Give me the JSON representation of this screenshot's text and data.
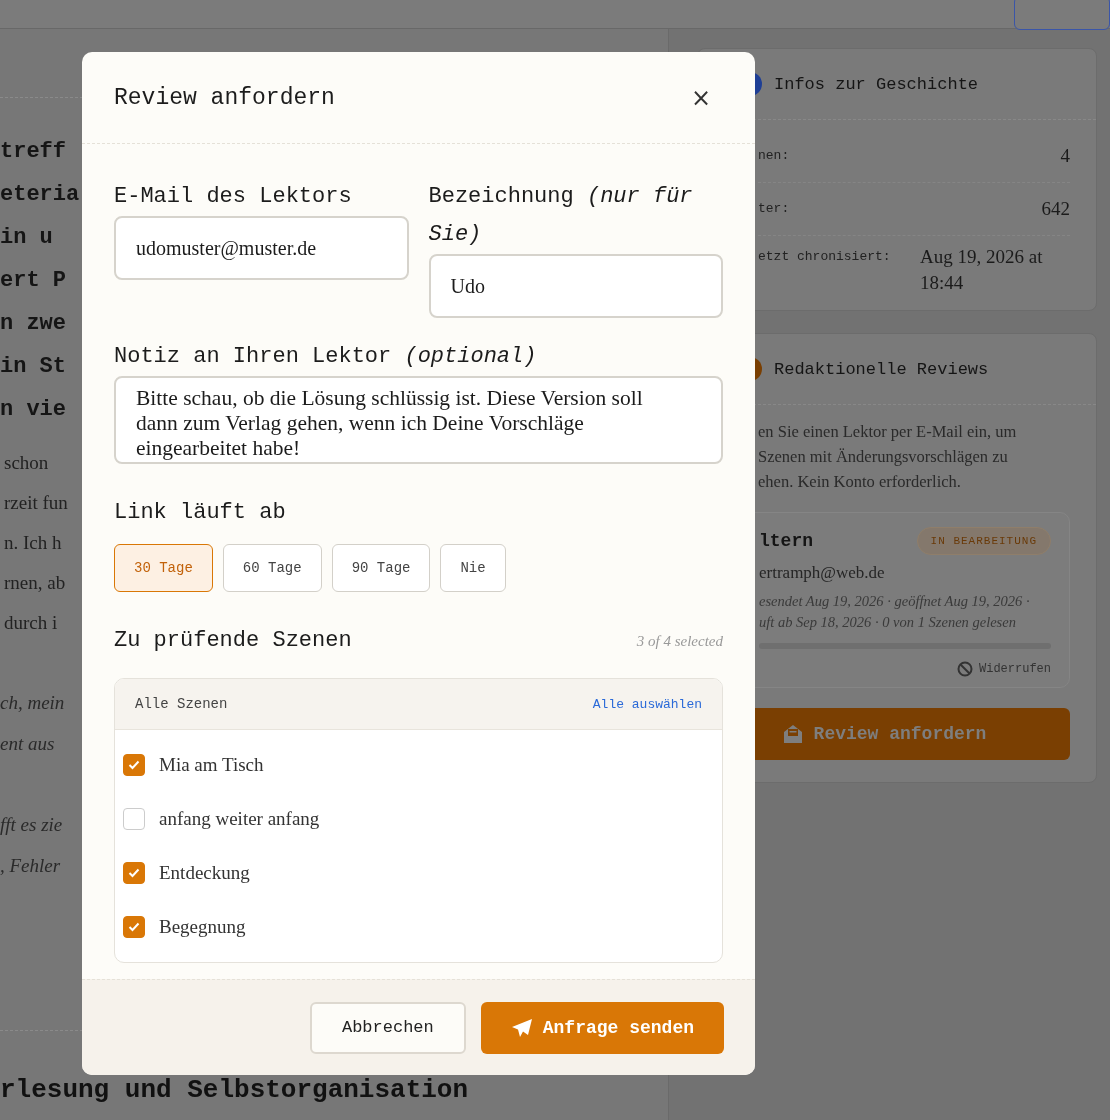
{
  "background": {
    "heading_fragments": [
      "treff",
      "eteria",
      "in u",
      "ert P",
      "n zwe",
      "in St",
      "n vie"
    ],
    "body_fragments": [
      "schon",
      "rzeit fun",
      "n. Ich h",
      "rnen, ab",
      "durch i"
    ],
    "quote_fragments": [
      "ch, mein",
      "ent aus",
      "fft es zie",
      ", Fehler"
    ],
    "bottom_heading": "rlesung und Selbstorganisation"
  },
  "sidebar": {
    "story_info": {
      "title": "Infos zur Geschichte",
      "rows": [
        {
          "label": "nen:",
          "value": "4"
        },
        {
          "label": "ter:",
          "value": "642"
        },
        {
          "label": "etzt chronisiert:",
          "value": "Aug 19, 2026 at 18:44"
        }
      ]
    },
    "reviews": {
      "title": "Redaktionelle Reviews",
      "description_lines": [
        "en Sie einen Lektor per E-Mail ein, um",
        "Szenen mit Änderungsvorschlägen zu",
        "ehen. Kein Konto erforderlich."
      ],
      "review": {
        "name": "ltern",
        "status": "IN BEARBEITUNG",
        "email": "ertramph@web.de",
        "meta_lines": [
          "esendet Aug 19, 2026 · geöffnet Aug 19, 2026 ·",
          "uft ab Sep 18, 2026 · 0 von 1 Szenen gelesen"
        ],
        "progress": {
          "level": 0
        },
        "revoke": "Widerrufen"
      },
      "button": "Review anfordern"
    }
  },
  "dialog": {
    "title": "Review anfordern",
    "close": "×",
    "email": {
      "label": "E-Mail des Lektors",
      "value": "udomuster@muster.de"
    },
    "name": {
      "label": "Bezeichnung *(nur für Sie)*",
      "value": "Udo"
    },
    "note": {
      "label": "Notiz an Ihren Lektor *(optional)*",
      "value": "Bitte schau, ob die Lösung schlüssig ist. Diese Version soll dann zum Verlag gehen, wenn ich Deine Vorschläge eingearbeitet habe!"
    },
    "expiry": {
      "label": "Link läuft ab",
      "options": [
        {
          "label": "30 Tage",
          "selected": true
        },
        {
          "label": "60 Tage",
          "selected": false
        },
        {
          "label": "90 Tage",
          "selected": false
        },
        {
          "label": "Nie",
          "selected": false
        }
      ]
    },
    "scenes": {
      "label": "Zu prüfende Szenen",
      "count": "3 of 4 selected",
      "group_label": "Alle Szenen",
      "select_all": "Alle auswählen",
      "items": [
        {
          "name": "Mia am Tisch",
          "checked": true
        },
        {
          "name": "anfang weiter anfang",
          "checked": false
        },
        {
          "name": "Entdeckung",
          "checked": true
        },
        {
          "name": "Begegnung",
          "checked": true
        }
      ]
    },
    "cancel": "Abbrechen",
    "submit": "Anfrage senden"
  }
}
